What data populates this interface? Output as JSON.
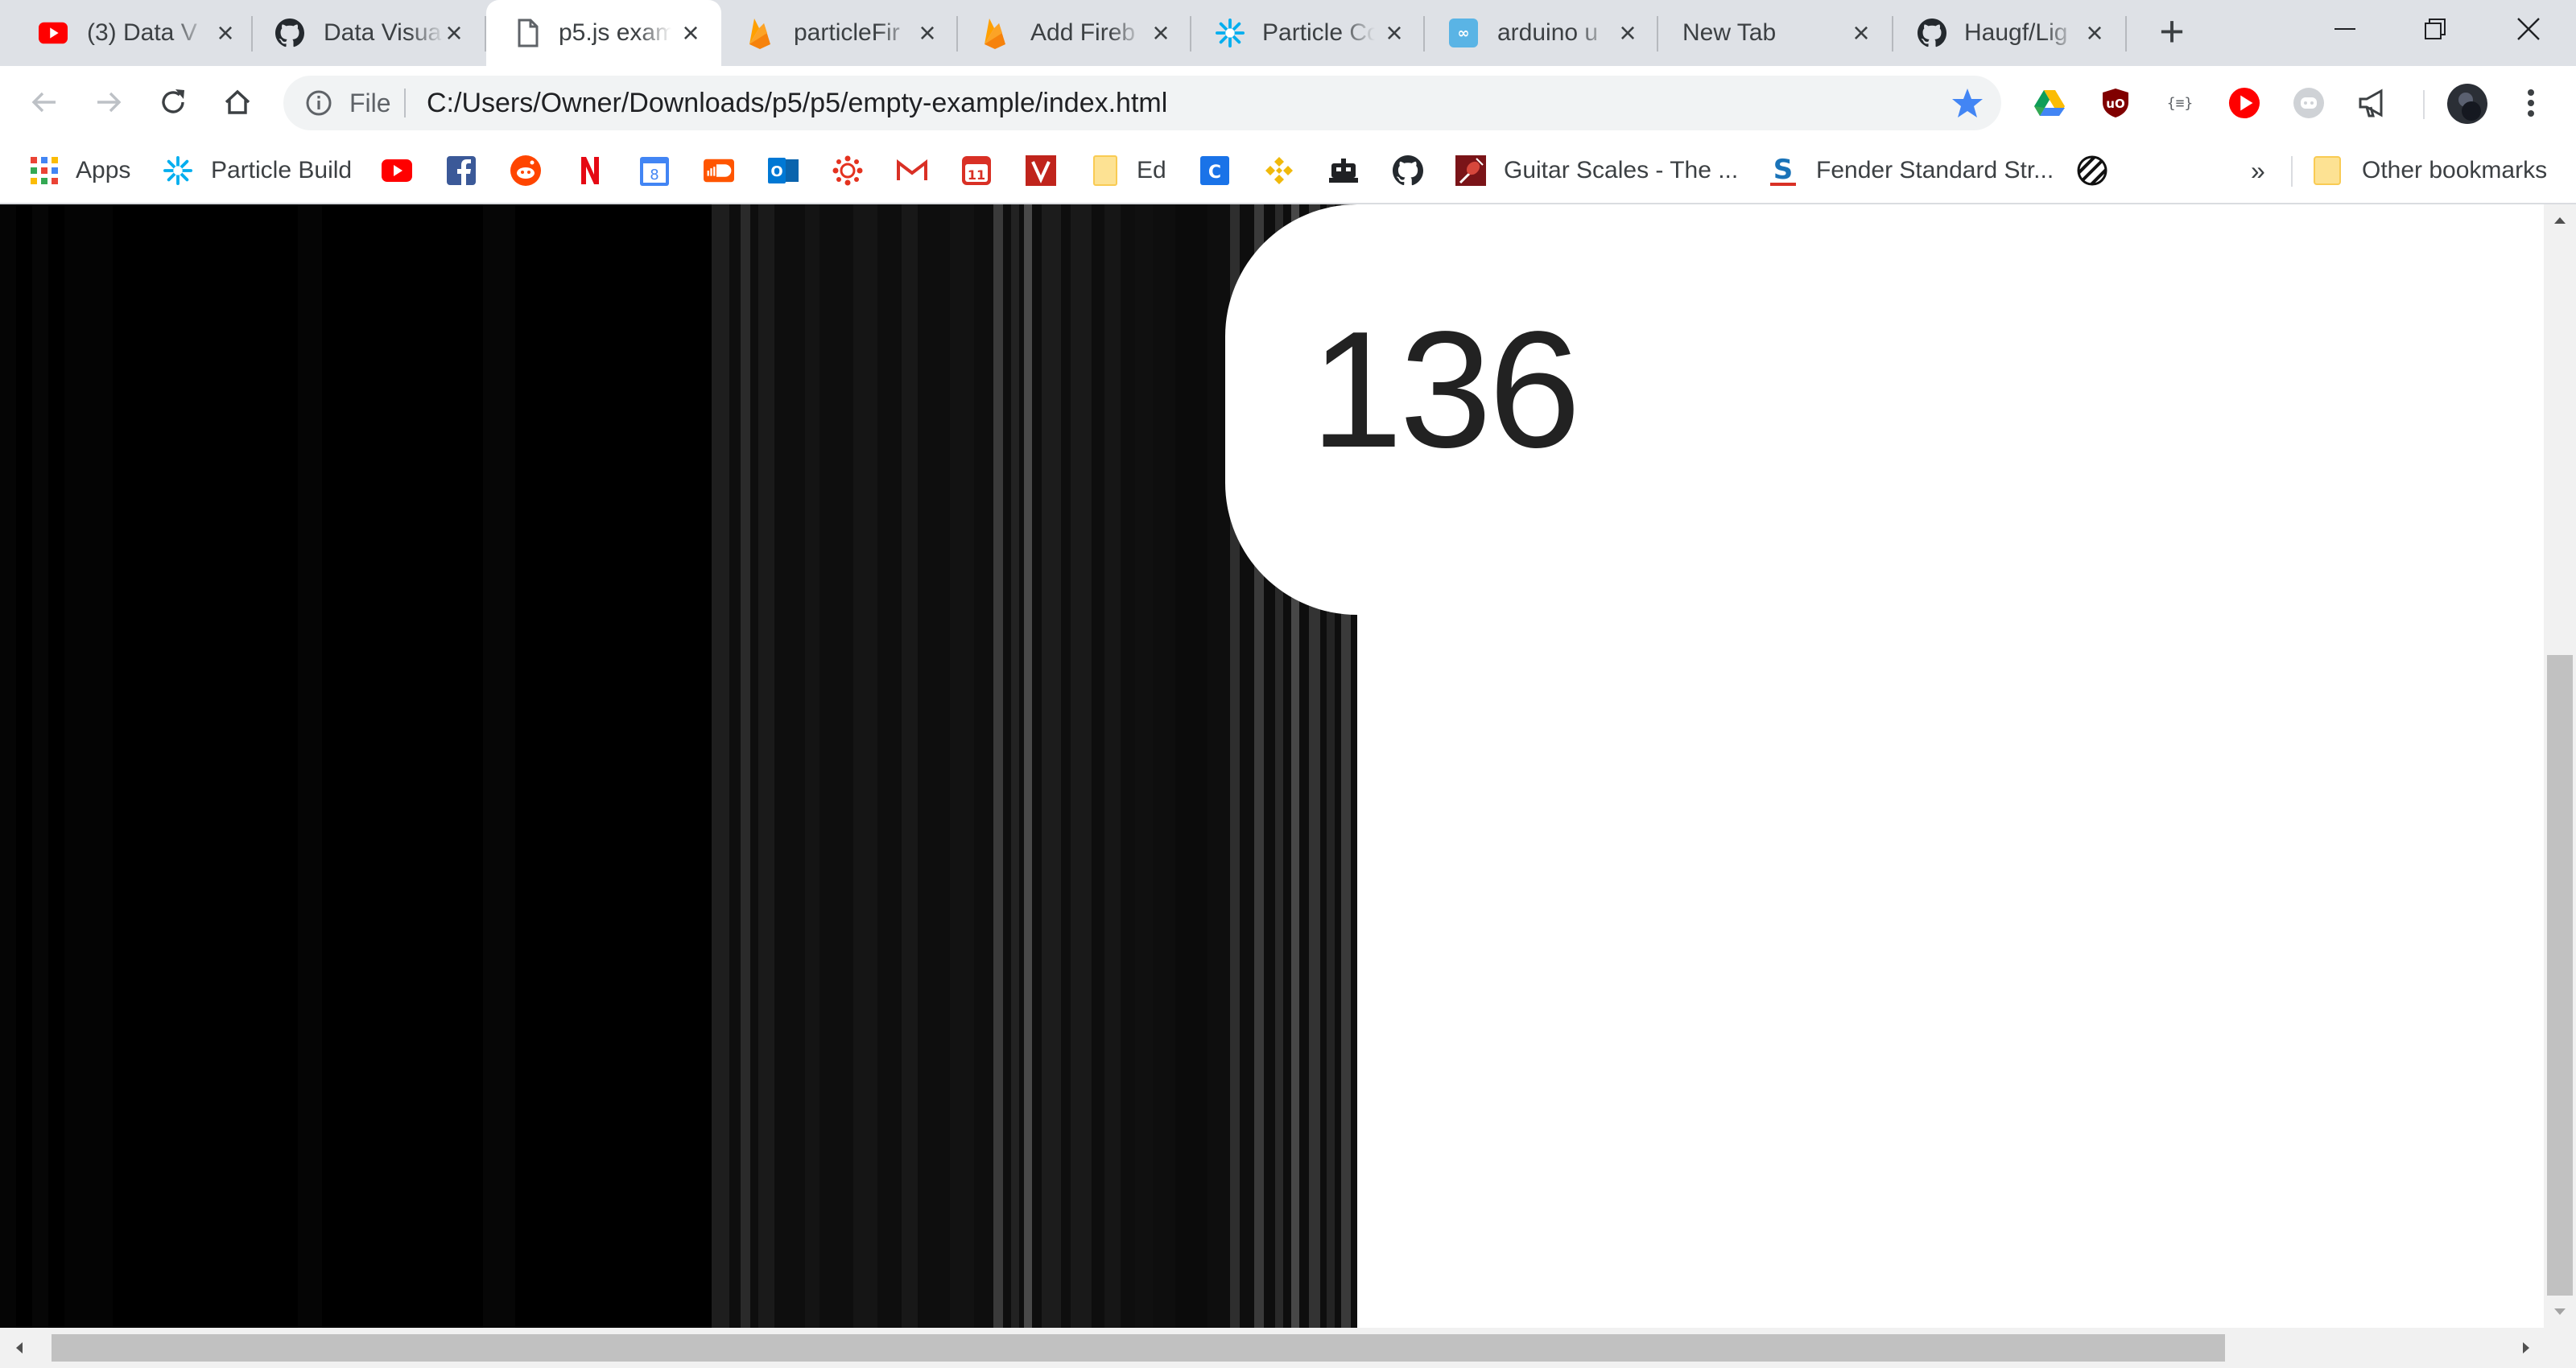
{
  "tabs": [
    {
      "title": "(3) Data V",
      "icon": "youtube-icon"
    },
    {
      "title": "Data Visua",
      "icon": "github-icon"
    },
    {
      "title": "p5.js exam",
      "icon": "file-icon",
      "active": true
    },
    {
      "title": "particleFir",
      "icon": "firebase-icon"
    },
    {
      "title": "Add Fireb",
      "icon": "firebase-icon"
    },
    {
      "title": "Particle Co",
      "icon": "particle-icon"
    },
    {
      "title": "arduino u",
      "icon": "arduino-icon"
    },
    {
      "title": "New Tab",
      "icon": ""
    },
    {
      "title": "Haugf/Lig",
      "icon": "github-icon"
    }
  ],
  "toolbar": {
    "scheme": "File",
    "url": "C:/Users/Owner/Downloads/p5/p5/empty-example/index.html"
  },
  "bookmarks": {
    "apps": "Apps",
    "particle_build": "Particle Build",
    "ed": "Ed",
    "guitar_scales": "Guitar Scales - The ...",
    "fender": "Fender Standard Str...",
    "more": "»",
    "other": "Other bookmarks"
  },
  "page": {
    "counter": "136"
  },
  "colors": {
    "accent_blue": "#4285f4",
    "tabstrip": "#dee1e6",
    "canvas": "#000000"
  }
}
